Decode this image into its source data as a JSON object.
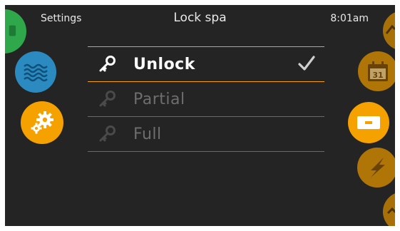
{
  "header": {
    "settings_label": "Settings",
    "title": "Lock spa",
    "clock": "8:01am"
  },
  "left_nav": [
    {
      "icon": "music-note-icon",
      "color": "#2ea84a"
    },
    {
      "icon": "water-waves-icon",
      "color": "#2b8bc1"
    },
    {
      "icon": "gear-icon",
      "color": "#f5a100"
    }
  ],
  "right_nav": [
    {
      "icon": "partial-top-icon",
      "color": "#d48a00"
    },
    {
      "icon": "calendar-icon",
      "color": "#d48a00",
      "text": "31"
    },
    {
      "icon": "screen-rectangle-icon",
      "color": "#f5a100",
      "active": true
    },
    {
      "icon": "lightning-icon",
      "color": "#d48a00"
    },
    {
      "icon": "partial-bottom-icon",
      "color": "#d48a00"
    }
  ],
  "lock_options": [
    {
      "label": "Unlock",
      "icon": "key-icon",
      "selected": true
    },
    {
      "label": "Partial",
      "icon": "key-icon",
      "selected": false
    },
    {
      "label": "Full",
      "icon": "key-icon",
      "selected": false
    }
  ],
  "colors": {
    "background": "#242424",
    "accent": "#f5a100",
    "text": "#ffffff",
    "dim_text": "#6e6e6e"
  }
}
